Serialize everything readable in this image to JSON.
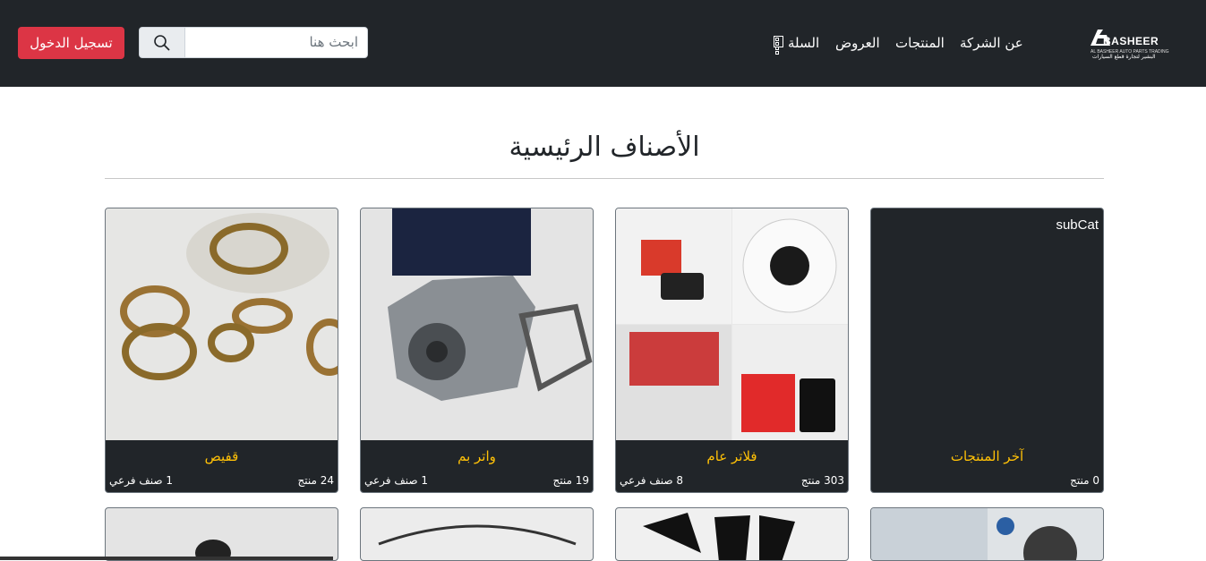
{
  "header": {
    "logo": {
      "brand": "BASHEER",
      "tagline_en": "AL BASHEER AUTO PARTS TRADING",
      "tagline_ar": "البشير لتجارة قطع السيارات"
    },
    "nav": [
      {
        "label": "عن الشركة"
      },
      {
        "label": "المنتجات"
      },
      {
        "label": "العروض"
      },
      {
        "label": "السلة"
      }
    ],
    "search": {
      "placeholder": "ابحث هنا"
    },
    "login_label": "تسجيل الدخول"
  },
  "main": {
    "title": "الأصناف الرئيسية",
    "categories": [
      {
        "name": "آخر المنتجات",
        "count": "0 منتج",
        "subcats": "",
        "badge": "subCat"
      },
      {
        "name": "فلاتر عام",
        "count": "303 منتج",
        "subcats": "8 صنف فرعي"
      },
      {
        "name": "واتر بم",
        "count": "19 منتج",
        "subcats": "1 صنف فرعي"
      },
      {
        "name": "قفيص",
        "count": "24 منتج",
        "subcats": "1 صنف فرعي"
      }
    ]
  },
  "colors": {
    "navbar": "#212529",
    "accent": "#ffc107",
    "login": "#dc3545"
  }
}
